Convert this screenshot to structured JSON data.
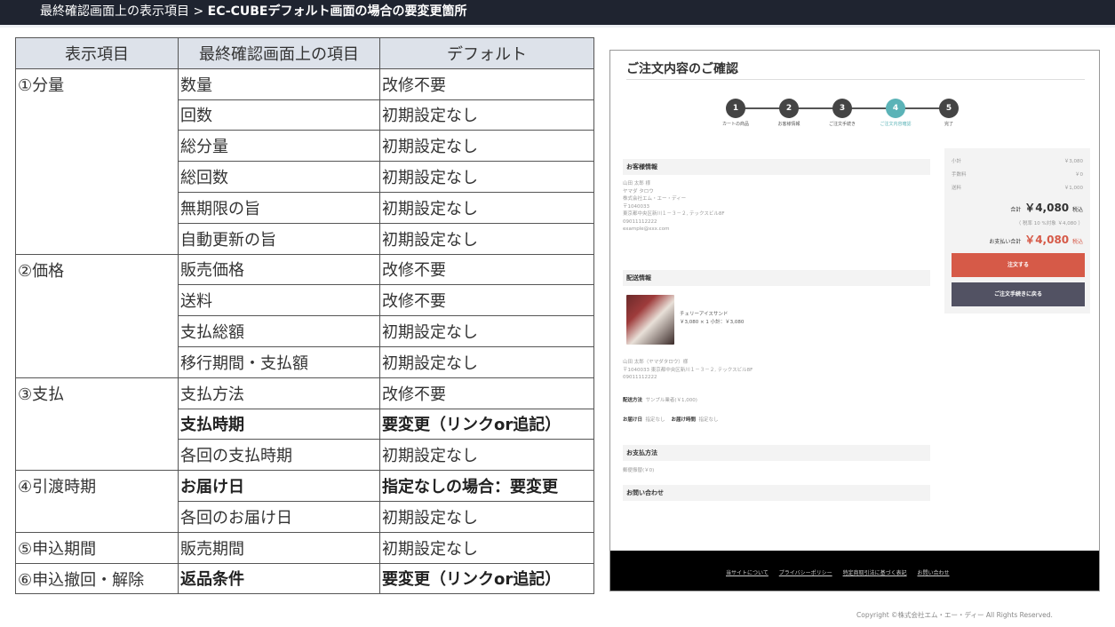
{
  "header": {
    "prefix": "最終確認画面上の表示項目 > ",
    "title": "EC-CUBEデフォルト画面の場合の要変更箇所"
  },
  "table": {
    "columns": [
      "表示項目",
      "最終確認画面上の項目",
      "デフォルト"
    ],
    "groups": {
      "g1": "①分量",
      "g2": "②価格",
      "g3": "③支払",
      "g4": "④引渡時期",
      "g5": "⑤申込期間",
      "g6": "⑥申込撤回・解除"
    },
    "rows": [
      {
        "item": "数量",
        "default": "改修不要"
      },
      {
        "item": "回数",
        "default": "初期設定なし"
      },
      {
        "item": "総分量",
        "default": "初期設定なし"
      },
      {
        "item": "総回数",
        "default": "初期設定なし"
      },
      {
        "item": "無期限の旨",
        "default": "初期設定なし"
      },
      {
        "item": "自動更新の旨",
        "default": "初期設定なし"
      },
      {
        "item": "販売価格",
        "default": "改修不要"
      },
      {
        "item": "送料",
        "default": "改修不要"
      },
      {
        "item": "支払総額",
        "default": "初期設定なし"
      },
      {
        "item": "移行期間・支払額",
        "default": "初期設定なし"
      },
      {
        "item": "支払方法",
        "default": "改修不要"
      },
      {
        "item": "支払時期",
        "default": "要変更（リンクor追記）"
      },
      {
        "item": "各回の支払時期",
        "default": "初期設定なし"
      },
      {
        "item": "お届け日",
        "default": "指定なしの場合：要変更"
      },
      {
        "item": "各回のお届け日",
        "default": "初期設定なし"
      },
      {
        "item": "販売期間",
        "default": "初期設定なし"
      },
      {
        "item": "返品条件",
        "default": "要変更（リンクor追記）"
      }
    ]
  },
  "screenshot": {
    "title": "ご注文内容のご確認",
    "steps": [
      {
        "num": "1",
        "label": "カートの商品"
      },
      {
        "num": "2",
        "label": "お客様情報"
      },
      {
        "num": "3",
        "label": "ご注文手続き"
      },
      {
        "num": "4",
        "label": "ご注文内容確認"
      },
      {
        "num": "5",
        "label": "完了"
      }
    ],
    "customer": {
      "header": "お客様情報",
      "lines": [
        "山田 太郎 様",
        "ヤマダ タロウ",
        "株式会社エム・エー・ディー",
        "〒1040033",
        "東京都中央区新川１－３－２, テックスビル8F",
        "09011112222",
        "example@xxx.com"
      ]
    },
    "shipping": {
      "header": "配送情報",
      "product_name": "チェリーアイスサンド",
      "product_price": "￥3,080 × 1  小計：￥3,080",
      "address_lines": [
        "山田 太郎（ヤマダタロウ）様",
        "〒1040033 東京都中央区新川１－３－２, テックスビル8F",
        "09011112222"
      ],
      "method_label": "配送方法",
      "method_value": "サンプル業者(￥1,000)",
      "date_label": "お届け日",
      "date_value": "指定なし",
      "time_label": "お届け時間",
      "time_value": "指定なし"
    },
    "payment": {
      "header": "お支払方法",
      "value": "郵便振替(￥0)"
    },
    "inquiry": {
      "header": "お問い合わせ"
    },
    "summary": {
      "subtotal_label": "小計",
      "subtotal_value": "￥3,080",
      "fee_label": "手数料",
      "fee_value": "￥0",
      "shipping_label": "送料",
      "shipping_value": "￥1,000",
      "total_label": "合計",
      "total_value": "￥4,080",
      "total_suffix": "税込",
      "tax_note": "（ 税率 10 %対象 ￥4,080 ）",
      "pay_label": "お支払い合計",
      "pay_value": "￥4,080",
      "pay_suffix": "税込",
      "order_button": "注文する",
      "back_button": "ご注文手続きに戻る"
    },
    "footer_links": [
      "当サイトについて",
      "プライバシーポリシー",
      "特定商取引法に基づく表記",
      "お問い合わせ"
    ],
    "copyright": "Copyright ©株式会社エム・エー・ディー All Rights Reserved."
  },
  "colors": {
    "header_bg": "#1f2430",
    "table_header_bg": "#dde2ea",
    "step_active": "#5bb3b7",
    "order_button": "#d65a48",
    "back_button": "#525263",
    "price_red": "#d65a48"
  }
}
